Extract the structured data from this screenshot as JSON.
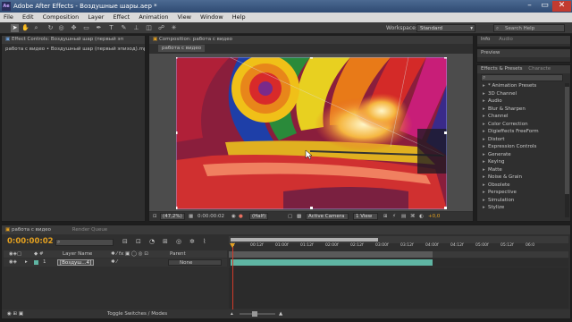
{
  "window": {
    "title": "Adobe After Effects - Воздушные шары.aep *",
    "app_icon": "Ae"
  },
  "menu": [
    "File",
    "Edit",
    "Composition",
    "Layer",
    "Effect",
    "Animation",
    "View",
    "Window",
    "Help"
  ],
  "toolbar": {
    "workspace_label": "Workspace:",
    "workspace_value": "Standard",
    "search_placeholder": "Search Help",
    "tool_icons": [
      "selection-tool",
      "hand-tool",
      "zoom-tool",
      "rotate-tool",
      "camera-tool",
      "pan-behind-tool",
      "mask-tool",
      "pen-tool",
      "text-tool",
      "brush-tool",
      "clone-stamp-tool",
      "eraser-tool",
      "roto-brush-tool",
      "puppet-tool"
    ]
  },
  "effect_controls": {
    "tab_label": "Effect Controls: Воздушный шар (первый эп",
    "breadcrumb": "работа с видео • Воздушный шар (первый эпизод).mp4"
  },
  "composition": {
    "tab_label": "Composition: работа с видео",
    "subtab": "работа с видео",
    "zoom": "(47,2%)",
    "timecode": "0:00:00:02",
    "resolution": "(Half)",
    "view": "Active Camera",
    "views": "1 View",
    "exposure": "+0,0"
  },
  "info_panel": {
    "tabs": [
      "Info",
      "Audio"
    ]
  },
  "preview_panel": {
    "tab": "Preview"
  },
  "effects_presets": {
    "tabs": [
      "Effects & Presets",
      "Characte"
    ],
    "items": [
      "* Animation Presets",
      "3D Channel",
      "Audio",
      "Blur & Sharpen",
      "Channel",
      "Color Correction",
      "Digieffects FreeForm",
      "Distort",
      "Expression Controls",
      "Generate",
      "Keying",
      "Matte",
      "Noise & Grain",
      "Obsolete",
      "Perspective",
      "Simulation",
      "Stylize"
    ]
  },
  "timeline": {
    "tabs": [
      "работа с видео",
      "Render Queue"
    ],
    "timecode": "0:00:00:02",
    "search_placeholder": "",
    "columns": {
      "layer_name": "Layer Name",
      "parent": "Parent"
    },
    "layers": [
      {
        "num": "1",
        "name": "[Воздуш...4]",
        "parent": "None"
      }
    ],
    "ruler_ticks": [
      "0f",
      "00:12f",
      "01:00f",
      "01:12f",
      "02:00f",
      "02:12f",
      "03:00f",
      "03:12f",
      "04:00f",
      "04:12f",
      "05:00f",
      "05:12f",
      "06:0"
    ],
    "footer": "Toggle Switches / Modes",
    "playhead_fraction": 0.0,
    "work_area_end_fraction": 0.6
  },
  "colors": {
    "accent_orange": "#e3a020",
    "layer_bar": "#5fb5a3",
    "track_green": "#4c8f3f",
    "playhead": "#d13b2a"
  }
}
